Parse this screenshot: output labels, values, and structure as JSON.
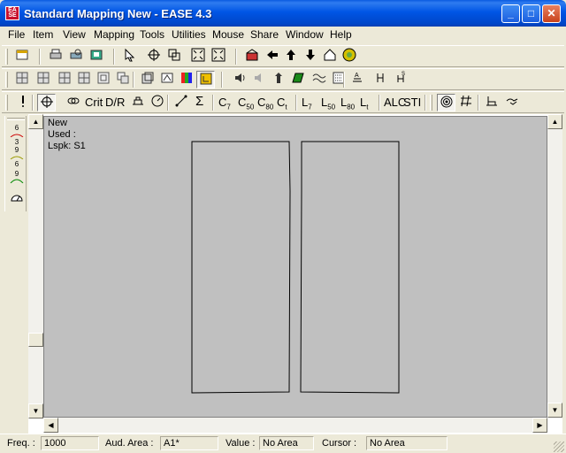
{
  "window": {
    "title": "Standard Mapping New - EASE 4.3",
    "icon_text": "EASE",
    "minimize": "_",
    "maximize": "□",
    "close": "✕"
  },
  "menu": [
    "File",
    "Item",
    "View",
    "Mapping",
    "Tools",
    "Utilities",
    "Mouse",
    "Share",
    "Window",
    "Help"
  ],
  "toolbar3_text": {
    "crit": "Crit",
    "dr": "D/R",
    "sigma": "Σ",
    "c7": "C",
    "c7_sub": "7",
    "c50": "C",
    "c50_sub": "50",
    "c80": "C",
    "c80_sub": "80",
    "ct": "C",
    "ct_sub": "t",
    "l7": "L",
    "l7_sub": "7",
    "l50": "L",
    "l50_sub": "50",
    "l80": "L",
    "l80_sub": "80",
    "lt": "L",
    "lt_sub": "t",
    "alc": "ALC",
    "sti": "STI"
  },
  "vtoolbar": [
    {
      "top": "6",
      "bottom": "3"
    },
    {
      "top": "9",
      "bottom": "6"
    },
    {
      "top": "9",
      "bottom": ""
    }
  ],
  "canvas": {
    "name": "New",
    "used": "Used :",
    "lspk": "Lspk: S1"
  },
  "status": {
    "freq_label": "Freq. :",
    "freq_value": "1000",
    "aud_label": "Aud. Area :",
    "aud_value": "A1*",
    "value_label": "Value :",
    "value_value": "No Area",
    "cursor_label": "Cursor :",
    "cursor_value": "No Area"
  },
  "colors": {
    "title_bar": "#0055e5",
    "canvas_bg": "#c0c0c0",
    "outline": "#000000"
  }
}
